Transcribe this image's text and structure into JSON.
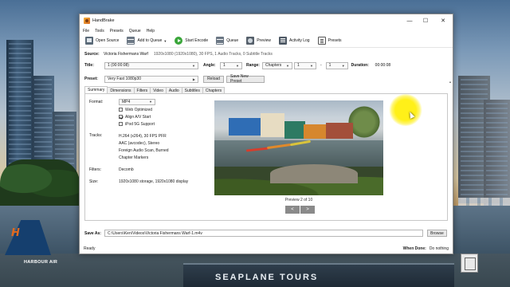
{
  "window": {
    "title": "HandBrake",
    "controls": {
      "minimize": "—",
      "maximize": "☐",
      "close": "✕"
    }
  },
  "menu": [
    "File",
    "Tools",
    "Presets",
    "Queue",
    "Help"
  ],
  "toolbar": {
    "open_source": "Open Source",
    "add_to_queue": "Add to Queue",
    "start_encode": "Start Encode",
    "queue": "Queue",
    "preview": "Preview",
    "activity_log": "Activity Log",
    "presets": "Presets"
  },
  "source": {
    "label": "Source:",
    "name": "Victoria Fishermans Warf",
    "details": "1920x1080 (1920x1080), 30 FPS, 1 Audio Tracks, 0 Subtitle Tracks"
  },
  "title_row": {
    "title_label": "Title:",
    "title_value": "1 (00:00:08)",
    "angle_label": "Angle:",
    "angle_value": "1",
    "range_label": "Range:",
    "range_value": "Chapters",
    "range_from": "1",
    "range_dash": "-",
    "range_to": "1",
    "duration_label": "Duration:",
    "duration_value": "00:00:08"
  },
  "preset_row": {
    "label": "Preset:",
    "value": "Very Fast 1080p30",
    "reload": "Reload",
    "save_new": "Save New Preset"
  },
  "tabs": [
    "Summary",
    "Dimensions",
    "Filters",
    "Video",
    "Audio",
    "Subtitles",
    "Chapters"
  ],
  "summary": {
    "format_label": "Format:",
    "format_value": "MP4",
    "web_optimized": {
      "label": "Web Optimized",
      "checked": false
    },
    "align_av": {
      "label": "Align A/V Start",
      "checked": true
    },
    "ipod": {
      "label": "iPod 5G Support",
      "checked": false
    },
    "tracks_label": "Tracks:",
    "tracks": [
      "H.264 (x264), 30 FPS PFR",
      "AAC (avcodec), Stereo",
      "Foreign Audio Scan, Burned",
      "Chapter Markers"
    ],
    "filters_label": "Filters:",
    "filters_value": "Decomb",
    "size_label": "Size:",
    "size_value": "1920x1080 storage, 1920x1080 display",
    "preview_caption": "Preview 2 of 10",
    "prev_btn": "<",
    "next_btn": ">"
  },
  "save_as": {
    "label": "Save As:",
    "value": "C:\\Users\\Ken\\Videos\\Victoria Fishermans Warf-1.m4v",
    "browse": "Browse"
  },
  "status": {
    "text": "Ready",
    "when_done_label": "When Done:",
    "when_done_value": "Do nothing"
  },
  "desktop": {
    "plane_logo": "H",
    "plane_text": "HARBOUR AIR",
    "dock_sign": "SEAPLANE TOURS"
  }
}
